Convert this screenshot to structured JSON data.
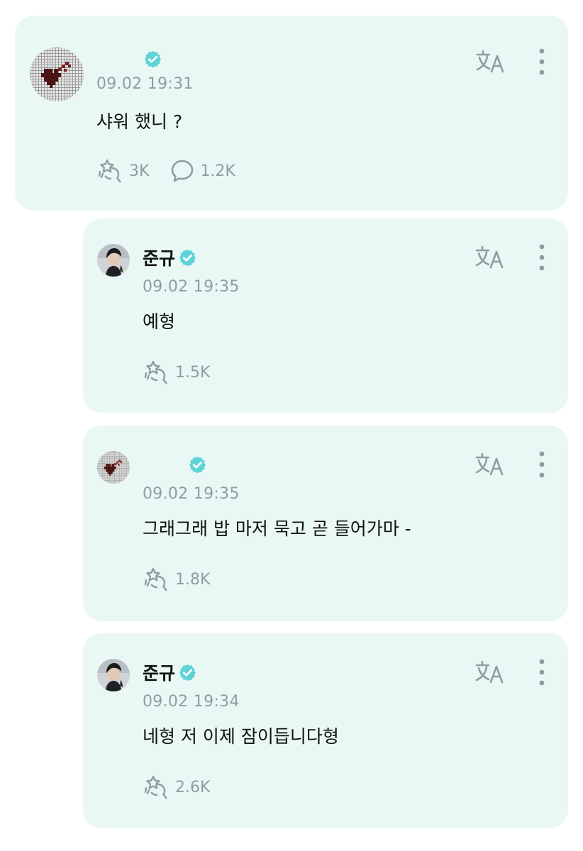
{
  "posts": [
    {
      "author": "",
      "verified": true,
      "timestamp": "09.02 19:31",
      "text": "샤워 했니 ?",
      "reactions": "3K",
      "comments": "1.2K"
    },
    {
      "author": "준규",
      "verified": true,
      "timestamp": "09.02 19:35",
      "text": "예형",
      "reactions": "1.5K"
    },
    {
      "author": "",
      "verified": true,
      "timestamp": "09.02 19:35",
      "text": "그래그래 밥 마저 묵고 곧 들어가마 -",
      "reactions": "1.8K"
    },
    {
      "author": "준규",
      "verified": true,
      "timestamp": "09.02 19:34",
      "text": "네형 저 이제 잠이듭니다형",
      "reactions": "2.6K"
    }
  ],
  "colors": {
    "card_background": "#e9f8f5",
    "verified_badge": "#5fd3d6",
    "icon_gray": "#8c9fa0",
    "heart_red": "#5a1a1a"
  },
  "icons": {
    "translate": "translate-icon",
    "more": "more-vertical-icon",
    "reaction": "sparkle-reaction-icon",
    "comment": "speech-bubble-icon",
    "verified": "verified-check-icon"
  }
}
